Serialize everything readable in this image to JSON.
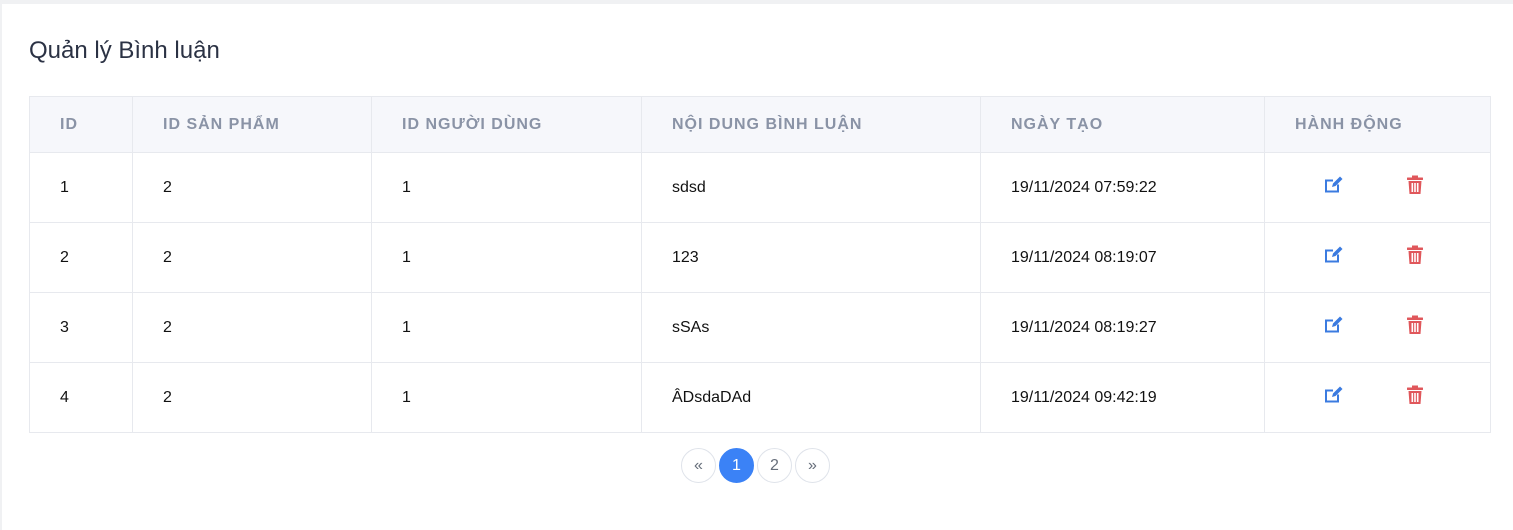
{
  "page": {
    "title": "Quản lý Bình luận"
  },
  "table": {
    "columns": [
      "ID",
      "ID SẢN PHẨM",
      "ID NGƯỜI DÙNG",
      "NỘI DUNG BÌNH LUẬN",
      "NGÀY TẠO",
      "HÀNH ĐỘNG"
    ],
    "rows": [
      {
        "id": "1",
        "product_id": "2",
        "user_id": "1",
        "content": "sdsd",
        "created": "19/11/2024 07:59:22"
      },
      {
        "id": "2",
        "product_id": "2",
        "user_id": "1",
        "content": "123",
        "created": "19/11/2024 08:19:07"
      },
      {
        "id": "3",
        "product_id": "2",
        "user_id": "1",
        "content": "sSAs",
        "created": "19/11/2024 08:19:27"
      },
      {
        "id": "4",
        "product_id": "2",
        "user_id": "1",
        "content": "ÂDsdaDAd",
        "created": "19/11/2024 09:42:19"
      }
    ],
    "actions": {
      "edit_icon": "edit-icon",
      "delete_icon": "trash-icon",
      "edit_color": "#3b7be0",
      "delete_color": "#e0575b"
    }
  },
  "pagination": {
    "prev": "«",
    "pages": [
      "1",
      "2"
    ],
    "next": "»",
    "current": "1",
    "accent": "#3b82f6"
  }
}
